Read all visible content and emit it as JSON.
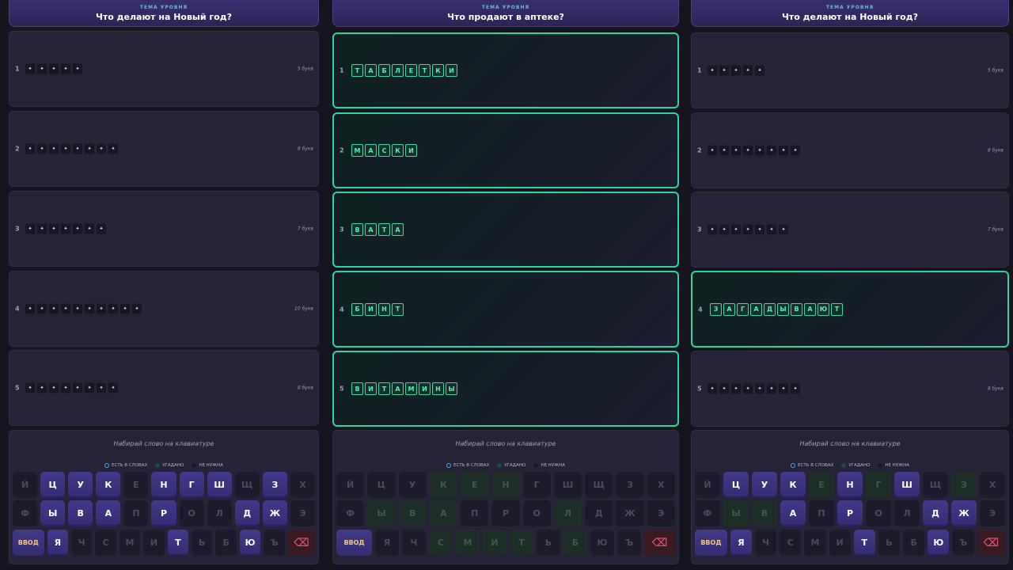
{
  "theme_label": "ТЕМА УРОВНЯ",
  "hint": "Набирай слово на клавиатуре",
  "legend": {
    "present": "ЕСТЬ В СЛОВАХ",
    "guessed": "УГАДАНО",
    "unneeded": "НЕ НУЖНА"
  },
  "keys": {
    "enter": "ВВОД",
    "row1": [
      "Й",
      "Ц",
      "У",
      "К",
      "Е",
      "Н",
      "Г",
      "Ш",
      "Щ",
      "З",
      "Х"
    ],
    "row2": [
      "Ф",
      "Ы",
      "В",
      "А",
      "П",
      "Р",
      "О",
      "Л",
      "Д",
      "Ж",
      "Э"
    ],
    "row3": [
      "Я",
      "Ч",
      "С",
      "М",
      "И",
      "Т",
      "Ь",
      "Б",
      "Ю",
      "Ъ"
    ]
  },
  "colors": {
    "accent": "#2fd4a5",
    "key_active": "#3d3480",
    "backspace": "#e0506a"
  },
  "panels": [
    {
      "title": "Что делают на Новый год?",
      "rows": [
        {
          "num": "1",
          "count": "5 букв"
        },
        {
          "num": "2",
          "count": "8 букв"
        },
        {
          "num": "3",
          "count": "7 букв"
        },
        {
          "num": "4",
          "count": "10 букв"
        },
        {
          "num": "5",
          "count": "8 букв"
        }
      ]
    },
    {
      "title": "Что продают в аптеке?",
      "rows": [
        {
          "num": "1",
          "word": "ТАБЛЕТКИ"
        },
        {
          "num": "2",
          "word": "МАСКИ"
        },
        {
          "num": "3",
          "word": "ВАТА"
        },
        {
          "num": "4",
          "word": "БИНТ"
        },
        {
          "num": "5",
          "word": "ВИТАМИНЫ"
        }
      ]
    },
    {
      "title": "Что делают на Новый год?",
      "rows": [
        {
          "num": "1",
          "count": "5 букв"
        },
        {
          "num": "2",
          "count": "8 букв"
        },
        {
          "num": "3",
          "count": "7 букв"
        },
        {
          "num": "4",
          "word": "ЗАГАДЫВАЮТ"
        },
        {
          "num": "5",
          "count": "8 букв"
        }
      ]
    }
  ]
}
